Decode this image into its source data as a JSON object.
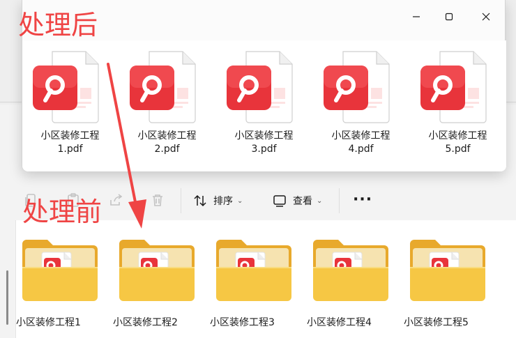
{
  "annotations": {
    "after_label": "处理后",
    "before_label": "处理前",
    "arrow_color": "#ef4444"
  },
  "after_window": {
    "controls": {
      "minimize_icon": "minimize-icon",
      "maximize_icon": "maximize-icon",
      "close_icon": "close-icon"
    },
    "files": [
      {
        "line1": "小区装修工程",
        "line2": "1.pdf",
        "icon": "wps-pdf-icon"
      },
      {
        "line1": "小区装修工程",
        "line2": "2.pdf",
        "icon": "wps-pdf-icon"
      },
      {
        "line1": "小区装修工程",
        "line2": "3.pdf",
        "icon": "wps-pdf-icon"
      },
      {
        "line1": "小区装修工程",
        "line2": "4.pdf",
        "icon": "wps-pdf-icon"
      },
      {
        "line1": "小区装修工程",
        "line2": "5.pdf",
        "icon": "wps-pdf-icon"
      }
    ]
  },
  "before_window": {
    "toolbar": {
      "sort_label": "排序",
      "view_label": "查看",
      "more_label": "···",
      "disabled_icons": [
        "copy-icon",
        "paste-icon",
        "share-icon",
        "delete-icon"
      ],
      "sort_icon": "sort-arrows-icon",
      "view_icon": "view-monitor-icon"
    },
    "folders": [
      {
        "name": "小区装修工程1",
        "icon": "folder-with-pdf-icon"
      },
      {
        "name": "小区装修工程2",
        "icon": "folder-with-pdf-icon"
      },
      {
        "name": "小区装修工程3",
        "icon": "folder-with-pdf-icon"
      },
      {
        "name": "小区装修工程4",
        "icon": "folder-with-pdf-icon"
      },
      {
        "name": "小区装修工程5",
        "icon": "folder-with-pdf-icon"
      }
    ]
  },
  "colors": {
    "pdf_red": "#e8343b",
    "folder_yellow": "#f6c744",
    "annotation_red": "#ef4444"
  }
}
